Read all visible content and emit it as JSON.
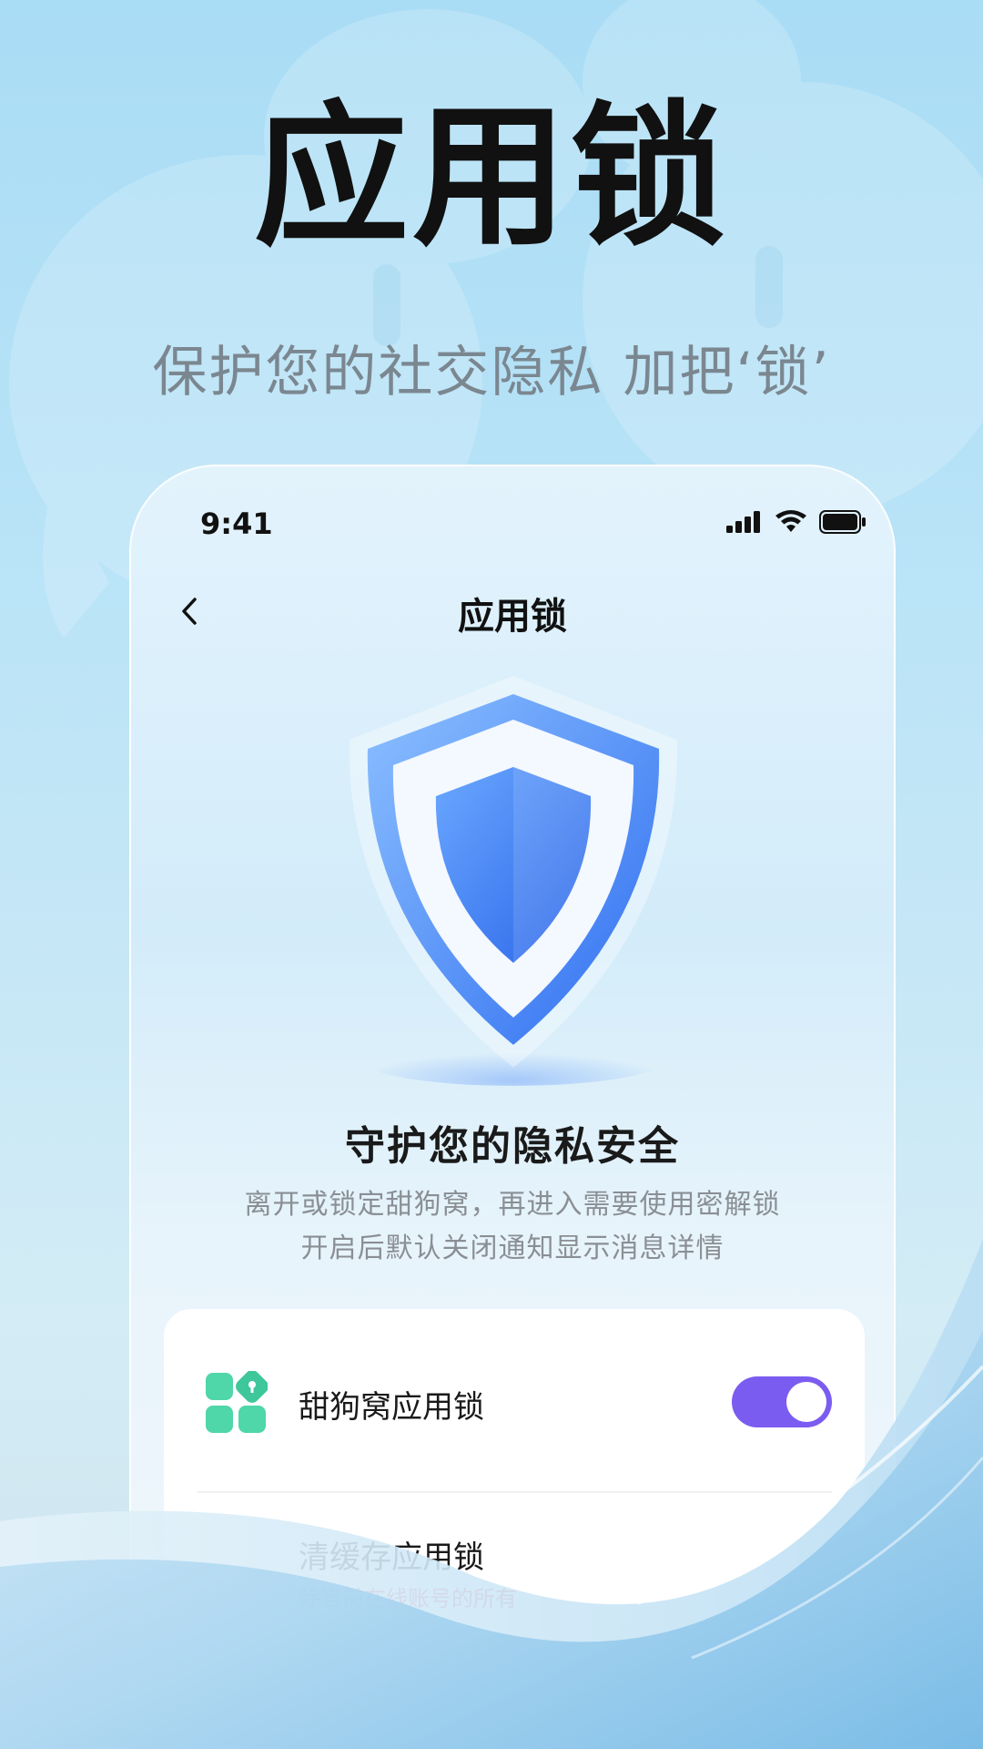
{
  "promo": {
    "headline": "应用锁",
    "subheadline": "保护您的社交隐私 加把‘锁’"
  },
  "status_bar": {
    "time": "9:41",
    "icons": [
      "signal-icon",
      "wifi-icon",
      "battery-icon"
    ]
  },
  "nav": {
    "title": "应用锁",
    "back_icon": "chevron-left-icon"
  },
  "hero": {
    "icon": "shield-icon",
    "title": "守护您的隐私安全",
    "description_line1": "离开或锁定甜狗窝，再进入需要使用密解锁",
    "description_line2": "开启后默认关闭通知显示消息详情"
  },
  "settings": {
    "items": [
      {
        "icon": "app-grid-lock-icon",
        "label": "甜狗窝应用锁",
        "toggle_on": true
      },
      {
        "label": "清缓存应用锁",
        "warning": "除当前在线账号的所有"
      }
    ]
  },
  "colors": {
    "accent": "#7b5cf0",
    "warning": "#ee5563",
    "icon_green": "#4fd6a9",
    "shield_blue": "#3d7ef7"
  }
}
